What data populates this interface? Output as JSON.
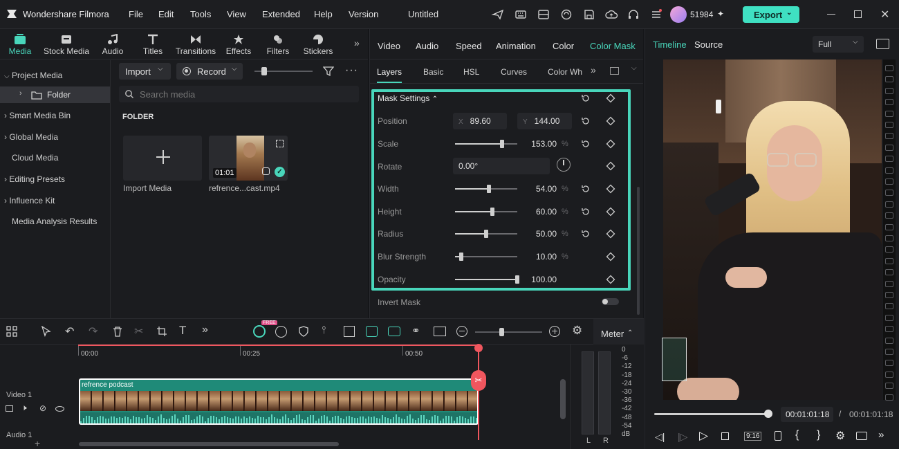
{
  "app": {
    "name": "Wondershare Filmora",
    "project_title": "Untitled",
    "credits": "51984",
    "export_label": "Export"
  },
  "menu": [
    "File",
    "Edit",
    "Tools",
    "View",
    "Extended",
    "Help",
    "Version"
  ],
  "media_tabs": [
    {
      "label": "Media",
      "icon": "media-icon"
    },
    {
      "label": "Stock Media",
      "icon": "stock-media-icon"
    },
    {
      "label": "Audio",
      "icon": "audio-icon"
    },
    {
      "label": "Titles",
      "icon": "titles-icon"
    },
    {
      "label": "Transitions",
      "icon": "transitions-icon"
    },
    {
      "label": "Effects",
      "icon": "effects-icon"
    },
    {
      "label": "Filters",
      "icon": "filters-icon"
    },
    {
      "label": "Stickers",
      "icon": "stickers-icon"
    }
  ],
  "sidebar": {
    "items": [
      {
        "label": "Project Media"
      },
      {
        "label": "Folder"
      },
      {
        "label": "Smart Media Bin"
      },
      {
        "label": "Global Media"
      },
      {
        "label": "Cloud Media"
      },
      {
        "label": "Editing Presets"
      },
      {
        "label": "Influence Kit"
      },
      {
        "label": "Media Analysis Results"
      }
    ]
  },
  "media_toolbar": {
    "import_label": "Import",
    "record_label": "Record",
    "search_placeholder": "Search media"
  },
  "media_grid": {
    "folder_label": "FOLDER",
    "import_tile_label": "Import Media",
    "clip_name": "refrence...cast.mp4",
    "clip_duration": "01:01"
  },
  "props": {
    "tabs": [
      "Video",
      "Audio",
      "Speed",
      "Animation",
      "Color",
      "Color Mask"
    ],
    "subtabs": [
      "Layers",
      "Basic",
      "HSL",
      "Curves",
      "Color Wh"
    ],
    "section_title": "Mask Settings",
    "position": {
      "label": "Position",
      "x_label": "X",
      "x": "89.60",
      "y_label": "Y",
      "y": "144.00"
    },
    "rotate": {
      "label": "Rotate",
      "value": "0.00°"
    },
    "rows": [
      {
        "label": "Scale",
        "value": "153.00",
        "unit": "%",
        "level": 0.76
      },
      {
        "label": "Width",
        "value": "54.00",
        "unit": "%",
        "level": 0.54
      },
      {
        "label": "Height",
        "value": "60.00",
        "unit": "%",
        "level": 0.6
      },
      {
        "label": "Radius",
        "value": "50.00",
        "unit": "%",
        "level": 0.5
      },
      {
        "label": "Blur Strength",
        "value": "10.00",
        "unit": "%",
        "level": 0.1
      },
      {
        "label": "Opacity",
        "value": "100.00",
        "unit": "",
        "level": 1.0
      }
    ],
    "invert_mask_label": "Invert Mask"
  },
  "preview": {
    "tabs": [
      "Timeline",
      "Source"
    ],
    "quality": "Full",
    "current_time": "00:01:01:18",
    "total_time": "00:01:01:18",
    "progress": 1.0
  },
  "timeline": {
    "ruler": [
      "00:00",
      "00:25",
      "00:50"
    ],
    "meter_label": "Meter",
    "meter_scale": [
      "0",
      "-6",
      "-12",
      "-18",
      "-24",
      "-30",
      "-36",
      "-42",
      "-48",
      "-54",
      "dB"
    ],
    "meter_channels": [
      "L",
      "R"
    ],
    "video_track_label": "Video 1",
    "audio_track_label": "Audio 1",
    "clip_title": "refrence podcast",
    "badge_free": "FREE"
  },
  "colors": {
    "accent": "#49d6bb",
    "export_bg": "#3fe0c2",
    "playhead": "#f0565e",
    "clip_bg": "#1f8a78"
  }
}
